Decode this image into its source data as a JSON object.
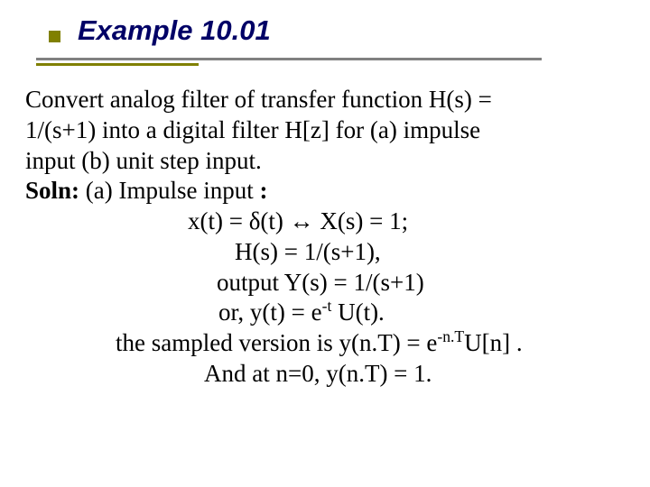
{
  "title": "Example 10.01",
  "body": {
    "l1": "Convert  analog filter of transfer function H(s) =",
    "l2": " 1/(s+1)  into  a digital filter H[z]  for  (a) impulse",
    "l3": " input  (b) unit step  input.",
    "l4a": "Soln:",
    "l4b": " (a) Impulse input ",
    "l4c": ":",
    "l5": "x(t) = δ(t) ↔ X(s) = 1;",
    "l6": "H(s) = 1/(s+1),",
    "l7": "output  Y(s) = 1/(s+1)",
    "l8a": "or,    y(t) = e",
    "l8sup": "-t",
    "l8b": " U(t).",
    "l9a": "the sampled version is y(n.T) = e",
    "l9sup": "-n.T",
    "l9b": "U[n] .",
    "l10": "And at n=0, y(n.T) = 1."
  }
}
